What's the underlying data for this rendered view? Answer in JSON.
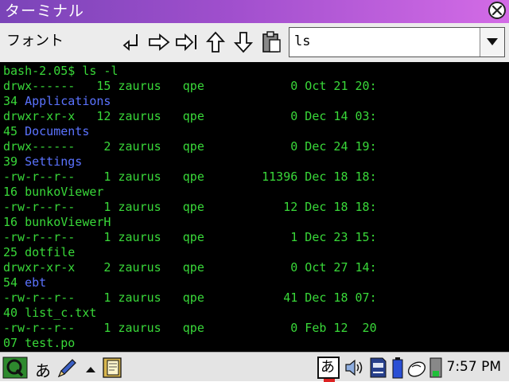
{
  "window": {
    "title": "ターミナル"
  },
  "toolbar": {
    "menu_label": "フォント",
    "command_value": "ls"
  },
  "colors": {
    "prompt": "#39d839",
    "directory": "#5b73ff",
    "background": "#000000"
  },
  "terminal": {
    "lines": [
      {
        "text": "bash-2.05$ ls -l",
        "kind": "prompt"
      },
      {
        "text": "drwx------   15 zaurus   qpe            0 Oct 21 20:",
        "kind": "plain"
      },
      {
        "text": "34 ",
        "kind": "plain",
        "name": "Applications"
      },
      {
        "text": "drwxr-xr-x   12 zaurus   qpe            0 Dec 14 03:",
        "kind": "plain"
      },
      {
        "text": "45 ",
        "kind": "plain",
        "name": "Documents"
      },
      {
        "text": "drwx------    2 zaurus   qpe            0 Dec 24 19:",
        "kind": "plain"
      },
      {
        "text": "39 ",
        "kind": "plain",
        "name": "Settings"
      },
      {
        "text": "-rw-r--r--    1 zaurus   qpe        11396 Dec 18 18:",
        "kind": "plain"
      },
      {
        "text": "16 bunkoViewer",
        "kind": "plain"
      },
      {
        "text": "-rw-r--r--    1 zaurus   qpe           12 Dec 18 18:",
        "kind": "plain"
      },
      {
        "text": "16 bunkoViewerH",
        "kind": "plain"
      },
      {
        "text": "-rw-r--r--    1 zaurus   qpe            1 Dec 23 15:",
        "kind": "plain"
      },
      {
        "text": "25 dotfile",
        "kind": "plain"
      },
      {
        "text": "drwxr-xr-x    2 zaurus   qpe            0 Oct 27 14:",
        "kind": "plain"
      },
      {
        "text": "54 ",
        "kind": "plain",
        "name": "ebt"
      },
      {
        "text": "-rw-r--r--    1 zaurus   qpe           41 Dec 18 07:",
        "kind": "plain"
      },
      {
        "text": "40 list_c.txt",
        "kind": "plain"
      },
      {
        "text": "-rw-r--r--    1 zaurus   qpe            0 Feb 12  20",
        "kind": "plain"
      },
      {
        "text": "07 test.po",
        "kind": "plain"
      }
    ]
  },
  "taskbar": {
    "input_mode": "あ",
    "ime_indicator": "あ",
    "clock": "7:57 PM"
  }
}
